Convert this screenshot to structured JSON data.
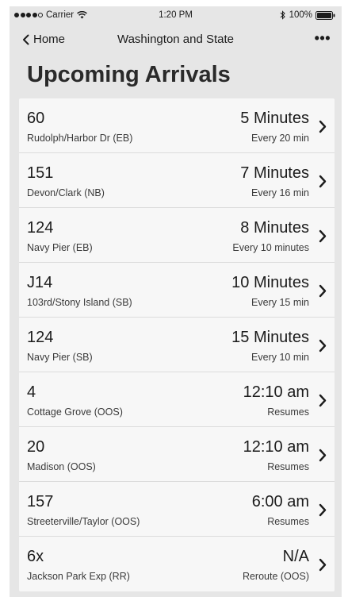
{
  "status_bar": {
    "carrier": "Carrier",
    "time": "1:20 PM",
    "battery": "100%",
    "icons": [
      "signal-dots-icon",
      "wifi-icon",
      "bluetooth-icon",
      "battery-icon"
    ]
  },
  "nav": {
    "back_label": "Home",
    "title": "Washington and State",
    "more_label": "•••"
  },
  "page_title": "Upcoming Arrivals",
  "arrivals": [
    {
      "route": "60",
      "stop": "Rudolph/Harbor Dr (EB)",
      "eta": "5 Minutes",
      "frequency": "Every 20 min"
    },
    {
      "route": "151",
      "stop": "Devon/Clark (NB)",
      "eta": "7 Minutes",
      "frequency": "Every 16 min"
    },
    {
      "route": "124",
      "stop": "Navy Pier (EB)",
      "eta": "8 Minutes",
      "frequency": "Every 10 minutes"
    },
    {
      "route": "J14",
      "stop": "103rd/Stony Island (SB)",
      "eta": "10 Minutes",
      "frequency": "Every 15 min"
    },
    {
      "route": "124",
      "stop": "Navy Pier (SB)",
      "eta": "15 Minutes",
      "frequency": "Every 10 min"
    },
    {
      "route": "4",
      "stop": "Cottage Grove (OOS)",
      "eta": "12:10 am",
      "frequency": "Resumes"
    },
    {
      "route": "20",
      "stop": "Madison (OOS)",
      "eta": "12:10 am",
      "frequency": "Resumes"
    },
    {
      "route": "157",
      "stop": "Streeterville/Taylor (OOS)",
      "eta": "6:00 am",
      "frequency": "Resumes"
    },
    {
      "route": "6x",
      "stop": "Jackson Park Exp (RR)",
      "eta": "N/A",
      "frequency": "Reroute (OOS)"
    }
  ]
}
